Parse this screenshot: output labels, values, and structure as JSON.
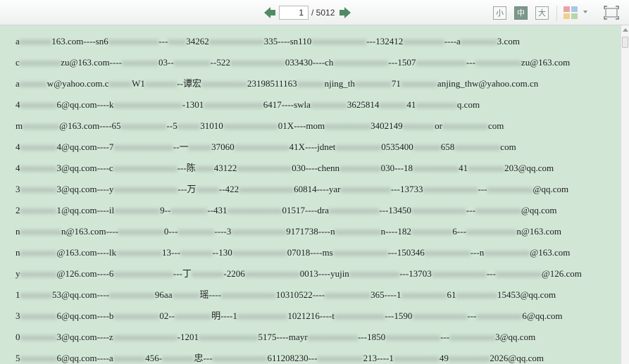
{
  "pager": {
    "current_page": "1",
    "total_label": "/ 5012",
    "prev_icon": "prev-page-arrow-icon",
    "next_icon": "next-page-arrow-icon"
  },
  "font_size": {
    "small": "小",
    "medium": "中",
    "large": "大",
    "active": "medium"
  },
  "view": {
    "layout_icon": "grid-layout-icon",
    "fullscreen_icon": "fullscreen-icon"
  },
  "colors": {
    "document_background": "#d2e6d6",
    "arrow_green": "#4f8a63",
    "active_size": "#7d988a"
  },
  "lines": [
    {
      "segs": [
        {
          "t": "a",
          "b": false
        },
        {
          "t": "xxxxxxx",
          "b": true
        },
        {
          "t": "163.com----sn6",
          "b": false
        },
        {
          "t": "xxxxxxxxxxx",
          "b": true
        },
        {
          "t": "---",
          "b": false
        },
        {
          "t": "xxxx",
          "b": true
        },
        {
          "t": "34262",
          "b": false
        },
        {
          "t": "xxxxxxxxxxxx",
          "b": true
        },
        {
          "t": "335----sn110",
          "b": false
        },
        {
          "t": "xxxxxxxxxxxx",
          "b": true
        },
        {
          "t": "---132412",
          "b": false
        },
        {
          "t": "xxxxxxxxx",
          "b": true
        },
        {
          "t": "----a",
          "b": false
        },
        {
          "t": "xxxxxxxx",
          "b": true
        },
        {
          "t": "3.com",
          "b": false
        }
      ]
    },
    {
      "segs": [
        {
          "t": "c",
          "b": false
        },
        {
          "t": "xxxxxxxxx",
          "b": true
        },
        {
          "t": "zu@163.com----",
          "b": false
        },
        {
          "t": "xxxxxxxx",
          "b": true
        },
        {
          "t": "03--",
          "b": false
        },
        {
          "t": "xxxxxxxx",
          "b": true
        },
        {
          "t": "--522",
          "b": false
        },
        {
          "t": "xxxxxxxxxxxx",
          "b": true
        },
        {
          "t": "033430----ch",
          "b": false
        },
        {
          "t": "xxxxxxxxxxxx",
          "b": true
        },
        {
          "t": "---1507",
          "b": false
        },
        {
          "t": "xxxxxxxxxxx",
          "b": true
        },
        {
          "t": "---",
          "b": false
        },
        {
          "t": "xxxxxxxxxx",
          "b": true
        },
        {
          "t": "zu@163.com",
          "b": false
        }
      ]
    },
    {
      "segs": [
        {
          "t": "a",
          "b": false
        },
        {
          "t": "xxxxxx",
          "b": true
        },
        {
          "t": "w@yahoo.com.c",
          "b": false
        },
        {
          "t": "xxxxx",
          "b": true
        },
        {
          "t": "W1",
          "b": false
        },
        {
          "t": "xxxxxxx",
          "b": true
        },
        {
          "t": "--谭宏",
          "b": false
        },
        {
          "t": "xxxxxxxxxx",
          "b": true
        },
        {
          "t": "23198511163",
          "b": false
        },
        {
          "t": "xxxxxx",
          "b": true
        },
        {
          "t": "njing_th",
          "b": false
        },
        {
          "t": "xxxxxxxx",
          "b": true
        },
        {
          "t": "71",
          "b": false
        },
        {
          "t": "xxxxxxxx",
          "b": true
        },
        {
          "t": "anjing_thw@yahoo.com.cn",
          "b": false
        }
      ]
    },
    {
      "segs": [
        {
          "t": "4",
          "b": false
        },
        {
          "t": "xxxxxxxx",
          "b": true
        },
        {
          "t": "6@qq.com----k",
          "b": false
        },
        {
          "t": "xxxxxxxxxxxxxxx",
          "b": true
        },
        {
          "t": "-1301",
          "b": false
        },
        {
          "t": "xxxxxxxxxxxxx",
          "b": true
        },
        {
          "t": "6417----swla",
          "b": false
        },
        {
          "t": "xxxxxxxx",
          "b": true
        },
        {
          "t": "3625814",
          "b": false
        },
        {
          "t": "xxxxxx",
          "b": true
        },
        {
          "t": "41",
          "b": false
        },
        {
          "t": "xxxxxxxxx",
          "b": true
        },
        {
          "t": "q.com",
          "b": false
        }
      ]
    },
    {
      "segs": [
        {
          "t": "m",
          "b": false
        },
        {
          "t": "xxxxxxxx",
          "b": true
        },
        {
          "t": "@163.com----65",
          "b": false
        },
        {
          "t": "xxxxxxxxxx",
          "b": true
        },
        {
          "t": "--5",
          "b": false
        },
        {
          "t": "xxxxx",
          "b": true
        },
        {
          "t": "31010",
          "b": false
        },
        {
          "t": "xxxxxxxxxxxx",
          "b": true
        },
        {
          "t": "01X----mom",
          "b": false
        },
        {
          "t": "xxxxxxxxxx",
          "b": true
        },
        {
          "t": "3402149",
          "b": false
        },
        {
          "t": "xxxxxxx",
          "b": true
        },
        {
          "t": "or",
          "b": false
        },
        {
          "t": "xxxxxxxxxx",
          "b": true
        },
        {
          "t": "com",
          "b": false
        }
      ]
    },
    {
      "segs": [
        {
          "t": "4",
          "b": false
        },
        {
          "t": "xxxxxxxx",
          "b": true
        },
        {
          "t": "4@qq.com----7",
          "b": false
        },
        {
          "t": "xxxxxxxxxxxxx",
          "b": true
        },
        {
          "t": "--一",
          "b": false
        },
        {
          "t": "xxxxx",
          "b": true
        },
        {
          "t": "37060",
          "b": false
        },
        {
          "t": "xxxxxxxxxxxx",
          "b": true
        },
        {
          "t": "41X----jdnet",
          "b": false
        },
        {
          "t": "xxxxxxxxxx",
          "b": true
        },
        {
          "t": "0535400",
          "b": false
        },
        {
          "t": "xxxxxx",
          "b": true
        },
        {
          "t": "658",
          "b": false
        },
        {
          "t": "xxxxxxxxxx",
          "b": true
        },
        {
          "t": "com",
          "b": false
        }
      ]
    },
    {
      "segs": [
        {
          "t": "4",
          "b": false
        },
        {
          "t": "xxxxxxxx",
          "b": true
        },
        {
          "t": "3@qq.com----c",
          "b": false
        },
        {
          "t": "xxxxxxxxxxxxxx",
          "b": true
        },
        {
          "t": "---陈",
          "b": false
        },
        {
          "t": "xxxx",
          "b": true
        },
        {
          "t": "43122",
          "b": false
        },
        {
          "t": "xxxxxxxxxxxx",
          "b": true
        },
        {
          "t": "030----chenn",
          "b": false
        },
        {
          "t": "xxxxxxxxx",
          "b": true
        },
        {
          "t": "030---18",
          "b": false
        },
        {
          "t": "xxxxxxxxxx",
          "b": true
        },
        {
          "t": "41",
          "b": false
        },
        {
          "t": "xxxxxxxx",
          "b": true
        },
        {
          "t": "203@qq.com",
          "b": false
        }
      ]
    },
    {
      "segs": [
        {
          "t": "3",
          "b": false
        },
        {
          "t": "xxxxxxxx",
          "b": true
        },
        {
          "t": "3@qq.com----y",
          "b": false
        },
        {
          "t": "xxxxxxxxxxxxxx",
          "b": true
        },
        {
          "t": "---万",
          "b": false
        },
        {
          "t": "xxxxx",
          "b": true
        },
        {
          "t": "--422",
          "b": false
        },
        {
          "t": "xxxxxxxxxxxx",
          "b": true
        },
        {
          "t": "60814----yar",
          "b": false
        },
        {
          "t": "xxxxxxxxxxx",
          "b": true
        },
        {
          "t": "---13733",
          "b": false
        },
        {
          "t": "xxxxxxxxxxxx",
          "b": true
        },
        {
          "t": "---",
          "b": false
        },
        {
          "t": "xxxxxxxxxx",
          "b": true
        },
        {
          "t": "@qq.com",
          "b": false
        }
      ]
    },
    {
      "segs": [
        {
          "t": "2",
          "b": false
        },
        {
          "t": "xxxxxxxx",
          "b": true
        },
        {
          "t": "1@qq.com----il",
          "b": false
        },
        {
          "t": "xxxxxxxxxx",
          "b": true
        },
        {
          "t": "9--",
          "b": false
        },
        {
          "t": "xxxxxxxx",
          "b": true
        },
        {
          "t": "--431",
          "b": false
        },
        {
          "t": "xxxxxxxxxxxx",
          "b": true
        },
        {
          "t": "01517----dra",
          "b": false
        },
        {
          "t": "xxxxxxxxxxx",
          "b": true
        },
        {
          "t": "---13450",
          "b": false
        },
        {
          "t": "xxxxxxxxxxxx",
          "b": true
        },
        {
          "t": "---",
          "b": false
        },
        {
          "t": "xxxxxxxxxx",
          "b": true
        },
        {
          "t": "@qq.com",
          "b": false
        }
      ]
    },
    {
      "segs": [
        {
          "t": "n",
          "b": false
        },
        {
          "t": "xxxxxxxxx",
          "b": true
        },
        {
          "t": "n@163.com----",
          "b": false
        },
        {
          "t": "xxxxxxxxxx",
          "b": true
        },
        {
          "t": "0---",
          "b": false
        },
        {
          "t": "xxxxxxxx",
          "b": true
        },
        {
          "t": "----3",
          "b": false
        },
        {
          "t": "xxxxxxxxxxxx",
          "b": true
        },
        {
          "t": "9171738----n",
          "b": false
        },
        {
          "t": "xxxxxxxxxx",
          "b": true
        },
        {
          "t": "n----182",
          "b": false
        },
        {
          "t": "xxxxxxxxx",
          "b": true
        },
        {
          "t": "6---",
          "b": false
        },
        {
          "t": "xxxxxxxxxxx",
          "b": true
        },
        {
          "t": "n@163.com",
          "b": false
        }
      ]
    },
    {
      "segs": [
        {
          "t": "n",
          "b": false
        },
        {
          "t": "xxxxxxxx",
          "b": true
        },
        {
          "t": "@163.com----lk",
          "b": false
        },
        {
          "t": "xxxxxxxxxx",
          "b": true
        },
        {
          "t": "13---",
          "b": false
        },
        {
          "t": "xxxxxxx",
          "b": true
        },
        {
          "t": "--130",
          "b": false
        },
        {
          "t": "xxxxxxxxxxxx",
          "b": true
        },
        {
          "t": "07018----ms",
          "b": false
        },
        {
          "t": "xxxxxxxxxxxx",
          "b": true
        },
        {
          "t": "---150346",
          "b": false
        },
        {
          "t": "xxxxxxxxxx",
          "b": true
        },
        {
          "t": "---n",
          "b": false
        },
        {
          "t": "xxxxxxxxxx",
          "b": true
        },
        {
          "t": "@163.com",
          "b": false
        }
      ]
    },
    {
      "segs": [
        {
          "t": "y",
          "b": false
        },
        {
          "t": "xxxxxxxx",
          "b": true
        },
        {
          "t": "@126.com----6",
          "b": false
        },
        {
          "t": "xxxxxxxxxxxxx",
          "b": true
        },
        {
          "t": "---丁",
          "b": false
        },
        {
          "t": "xxxxxxx",
          "b": true
        },
        {
          "t": "-2206",
          "b": false
        },
        {
          "t": "xxxxxxxxxxxx",
          "b": true
        },
        {
          "t": "0013----yujin",
          "b": false
        },
        {
          "t": "xxxxxxxxxxx",
          "b": true
        },
        {
          "t": "---13703",
          "b": false
        },
        {
          "t": "xxxxxxxxxxxx",
          "b": true
        },
        {
          "t": "---",
          "b": false
        },
        {
          "t": "xxxxxxxxxx",
          "b": true
        },
        {
          "t": "@126.com",
          "b": false
        }
      ]
    },
    {
      "segs": [
        {
          "t": "1",
          "b": false
        },
        {
          "t": "xxxxxxx",
          "b": true
        },
        {
          "t": "53@qq.com----",
          "b": false
        },
        {
          "t": "xxxxxxxxxx",
          "b": true
        },
        {
          "t": "96aa",
          "b": false
        },
        {
          "t": "xxxxxx",
          "b": true
        },
        {
          "t": "瑶----",
          "b": false
        },
        {
          "t": "xxxxxxxxxxxx",
          "b": true
        },
        {
          "t": "10310522----",
          "b": false
        },
        {
          "t": "xxxxxxxxxx",
          "b": true
        },
        {
          "t": "365----1",
          "b": false
        },
        {
          "t": "xxxxxxxxxx",
          "b": true
        },
        {
          "t": "61",
          "b": false
        },
        {
          "t": "xxxxxxxxx",
          "b": true
        },
        {
          "t": "15453@qq.com",
          "b": false
        }
      ]
    },
    {
      "segs": [
        {
          "t": "3",
          "b": false
        },
        {
          "t": "xxxxxxxx",
          "b": true
        },
        {
          "t": "6@qq.com----b",
          "b": false
        },
        {
          "t": "xxxxxxxxxx",
          "b": true
        },
        {
          "t": "02--",
          "b": false
        },
        {
          "t": "xxxxxxxx",
          "b": true
        },
        {
          "t": "明----1",
          "b": false
        },
        {
          "t": "xxxxxxxxxxx",
          "b": true
        },
        {
          "t": "1021216----t",
          "b": false
        },
        {
          "t": "xxxxxxxxxxx",
          "b": true
        },
        {
          "t": "---1590",
          "b": false
        },
        {
          "t": "xxxxxxxxxxxx",
          "b": true
        },
        {
          "t": "---",
          "b": false
        },
        {
          "t": "xxxxxxxxxx",
          "b": true
        },
        {
          "t": "6@qq.com",
          "b": false
        }
      ]
    },
    {
      "segs": [
        {
          "t": "0",
          "b": false
        },
        {
          "t": "xxxxxxxx",
          "b": true
        },
        {
          "t": "3@qq.com----z",
          "b": false
        },
        {
          "t": "xxxxxxxxxxxxxx",
          "b": true
        },
        {
          "t": "-1201",
          "b": false
        },
        {
          "t": "xxxxxxxxxxxxx",
          "b": true
        },
        {
          "t": "5175----mayr",
          "b": false
        },
        {
          "t": "xxxxxxxxxxx",
          "b": true
        },
        {
          "t": "---1850",
          "b": false
        },
        {
          "t": "xxxxxxxxxxxx",
          "b": true
        },
        {
          "t": "---",
          "b": false
        },
        {
          "t": "xxxxxxxxxx",
          "b": true
        },
        {
          "t": "3@qq.com",
          "b": false
        }
      ]
    },
    {
      "segs": [
        {
          "t": "5",
          "b": false
        },
        {
          "t": "xxxxxxxx",
          "b": true
        },
        {
          "t": "6@qq.com----a",
          "b": false
        },
        {
          "t": "xxxxxxx",
          "b": true
        },
        {
          "t": "456-",
          "b": false
        },
        {
          "t": "xxxxxxx",
          "b": true
        },
        {
          "t": "忠---",
          "b": false
        },
        {
          "t": "xxxxxxxxxxxx",
          "b": true
        },
        {
          "t": "611208230---",
          "b": false
        },
        {
          "t": "xxxxxxxxxx",
          "b": true
        },
        {
          "t": "213----1",
          "b": false
        },
        {
          "t": "xxxxxxxxxx",
          "b": true
        },
        {
          "t": "49",
          "b": false
        },
        {
          "t": "xxxxxxxxx",
          "b": true
        },
        {
          "t": "2026@qq.com",
          "b": false
        }
      ]
    }
  ]
}
